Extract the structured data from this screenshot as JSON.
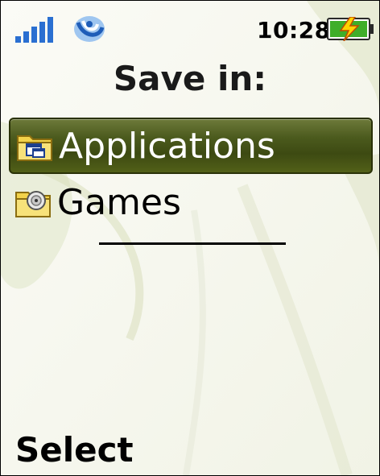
{
  "status_bar": {
    "time": "10:28",
    "signal_icon": "signal-bars-icon",
    "network_icon": "network-swirl-icon",
    "battery_icon": "battery-charging-icon"
  },
  "dialog": {
    "title": "Save in:"
  },
  "folders": [
    {
      "label": "Applications",
      "icon": "applications-folder-icon",
      "selected": true
    },
    {
      "label": "Games",
      "icon": "games-folder-icon",
      "selected": false
    }
  ],
  "softkeys": {
    "left": "Select"
  },
  "colors": {
    "selection": "#4b5a1d",
    "accent_blue": "#2a6fd1",
    "battery_green": "#3fae2a",
    "folder_yellow": "#f2d24a"
  }
}
